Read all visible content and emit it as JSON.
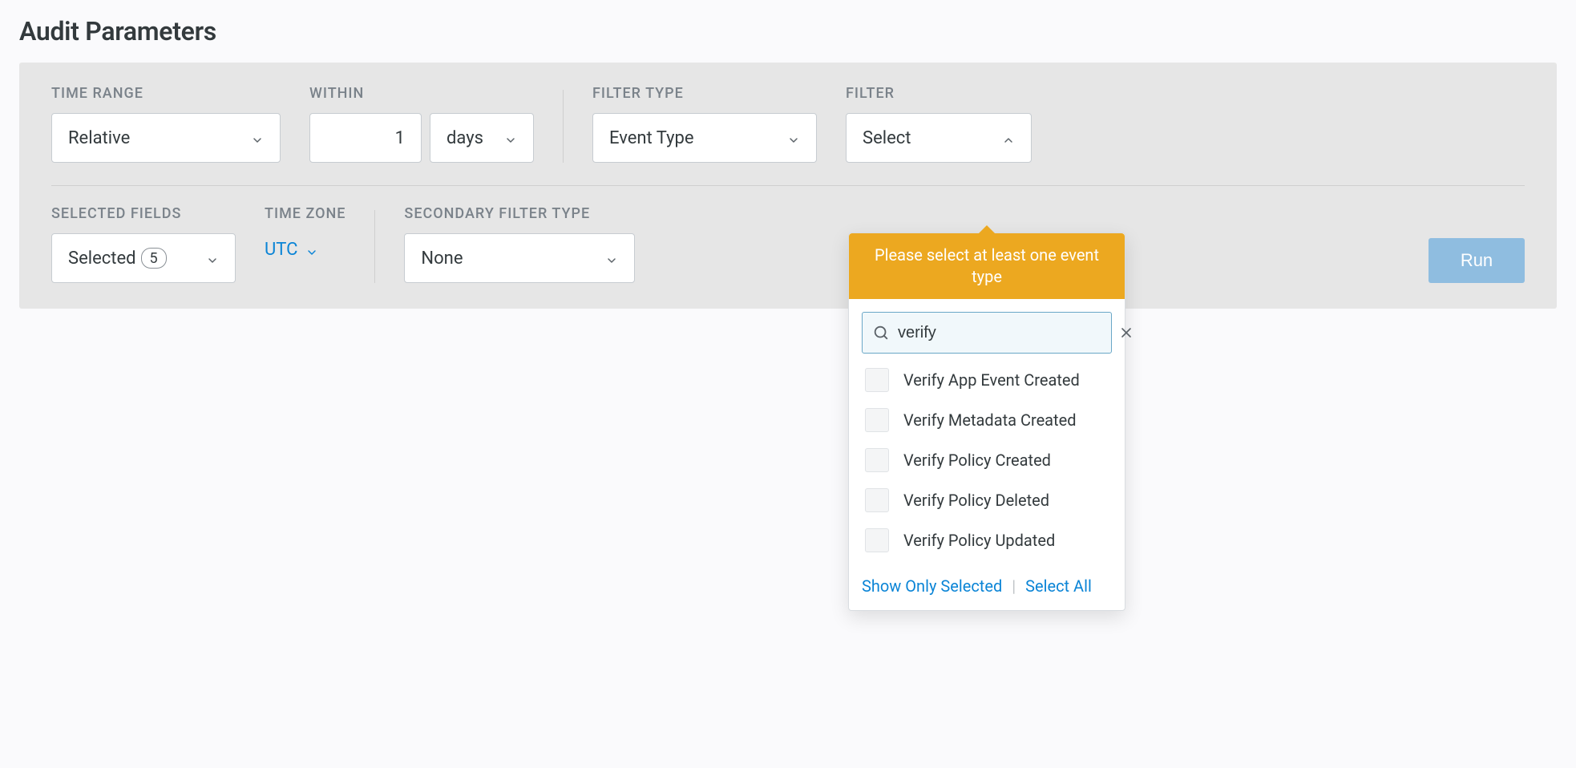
{
  "title": "Audit Parameters",
  "labels": {
    "time_range": "TIME RANGE",
    "within": "WITHIN",
    "filter_type": "FILTER TYPE",
    "filter": "FILTER",
    "selected_fields": "SELECTED FIELDS",
    "time_zone": "TIME ZONE",
    "secondary_filter_type": "SECONDARY FILTER TYPE"
  },
  "time_range": {
    "value": "Relative"
  },
  "within": {
    "number": "1",
    "unit": "days"
  },
  "filter_type": {
    "value": "Event Type"
  },
  "filter": {
    "value": "Select"
  },
  "selected_fields": {
    "label": "Selected",
    "count": "5"
  },
  "time_zone": {
    "value": "UTC"
  },
  "secondary_filter_type": {
    "value": "None"
  },
  "run_label": "Run",
  "popover": {
    "banner": "Please select at least one event type",
    "search_value": "verify",
    "options": [
      "Verify App Event Created",
      "Verify Metadata Created",
      "Verify Policy Created",
      "Verify Policy Deleted",
      "Verify Policy Updated"
    ],
    "show_only_selected": "Show Only Selected",
    "select_all": "Select All"
  }
}
